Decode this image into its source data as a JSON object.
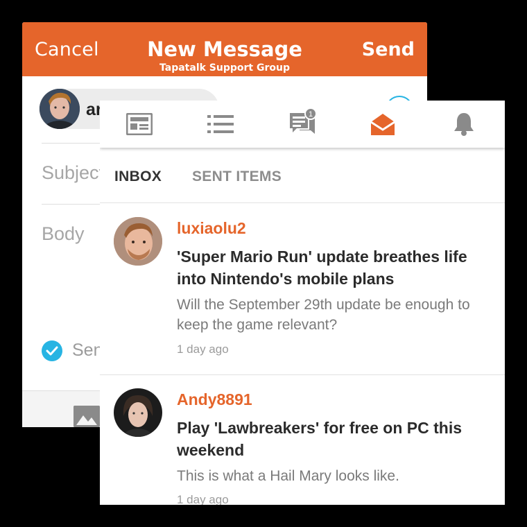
{
  "compose": {
    "cancel_label": "Cancel",
    "title": "New Message",
    "subtitle": "Tapatalk Support Group",
    "send_label": "Send",
    "recipient_name_partial": "ar",
    "subject_placeholder": "Subject",
    "body_placeholder": "Body",
    "send_option_partial": "Sen"
  },
  "nav": {
    "icons": [
      "feed-icon",
      "list-icon",
      "chat-icon",
      "envelope-icon",
      "bell-icon"
    ],
    "chat_badge": "1",
    "active_index": 3,
    "active_color": "#e5652b",
    "inactive_color": "#8a8a8a"
  },
  "tabs": [
    {
      "label": "INBOX",
      "active": true
    },
    {
      "label": "SENT ITEMS",
      "active": false
    }
  ],
  "messages": [
    {
      "author": "luxiaolu2",
      "subject": "'Super Mario Run' update breathes life into Nintendo's mobile plans",
      "preview": "Will the September 29th update be enough to keep the game relevant?",
      "time": "1 day ago"
    },
    {
      "author": "Andy8891",
      "subject": "Play 'Lawbreakers' for free on PC this weekend",
      "preview": "This is what a Hail Mary looks like.",
      "time": "1 day ago"
    }
  ],
  "colors": {
    "accent": "#e5652b",
    "check_blue": "#27b4e3"
  }
}
